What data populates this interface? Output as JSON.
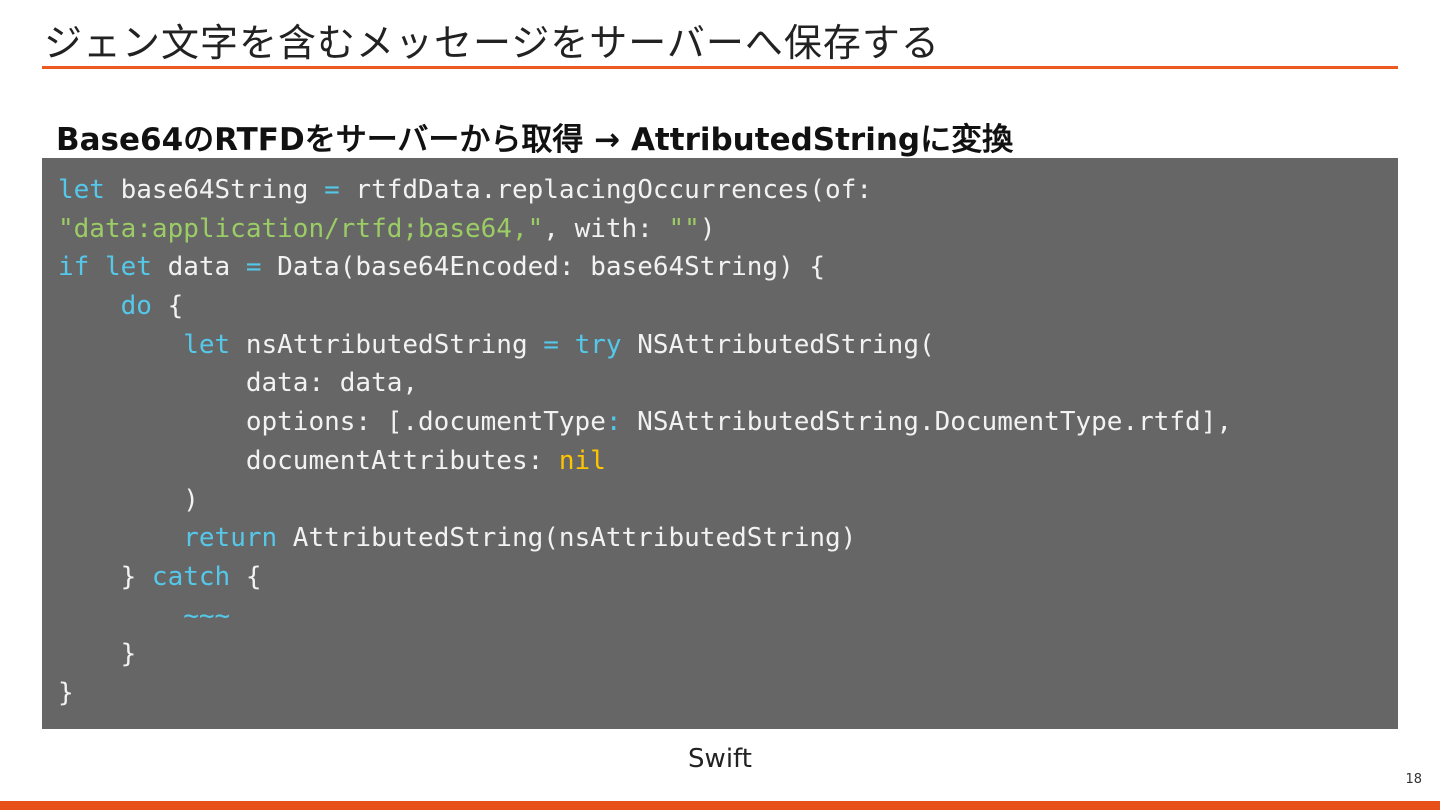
{
  "slide": {
    "title": "ジェン文字を含むメッセージをサーバーへ保存する",
    "subheading": "Base64のRTFDをサーバーから取得 → AttributedStringに変換",
    "code_language": "Swift",
    "page_number": "18"
  },
  "colors": {
    "accent": "#ec5a1f",
    "code_background": "#666666",
    "code_text": "#f2f2f2",
    "keyword": "#55c8ea",
    "string": "#9ccc65",
    "literal": "#ffc400"
  },
  "code_lines": [
    [
      {
        "t": "kw",
        "v": "let"
      },
      {
        "t": "plain",
        "v": " base64String "
      },
      {
        "t": "kw",
        "v": "="
      },
      {
        "t": "plain",
        "v": " rtfdData.replacingOccurrences(of:"
      }
    ],
    [
      {
        "t": "str",
        "v": "\"data:application/rtfd;base64,\""
      },
      {
        "t": "plain",
        "v": ", with: "
      },
      {
        "t": "str",
        "v": "\"\""
      },
      {
        "t": "plain",
        "v": ")"
      }
    ],
    [
      {
        "t": "kw",
        "v": "if"
      },
      {
        "t": "plain",
        "v": " "
      },
      {
        "t": "kw",
        "v": "let"
      },
      {
        "t": "plain",
        "v": " data "
      },
      {
        "t": "kw",
        "v": "="
      },
      {
        "t": "plain",
        "v": " Data(base64Encoded: base64String) {"
      }
    ],
    [
      {
        "t": "plain",
        "v": "    "
      },
      {
        "t": "kw",
        "v": "do"
      },
      {
        "t": "plain",
        "v": " {"
      }
    ],
    [
      {
        "t": "plain",
        "v": "        "
      },
      {
        "t": "kw",
        "v": "let"
      },
      {
        "t": "plain",
        "v": " nsAttributedString "
      },
      {
        "t": "kw",
        "v": "="
      },
      {
        "t": "plain",
        "v": " "
      },
      {
        "t": "kw",
        "v": "try"
      },
      {
        "t": "plain",
        "v": " NSAttributedString("
      }
    ],
    [
      {
        "t": "plain",
        "v": "            data: data,"
      }
    ],
    [
      {
        "t": "plain",
        "v": "            options: [.documentType"
      },
      {
        "t": "kw",
        "v": ":"
      },
      {
        "t": "plain",
        "v": " NSAttributedString.DocumentType.rtfd],"
      }
    ],
    [
      {
        "t": "plain",
        "v": "            documentAttributes: "
      },
      {
        "t": "lit",
        "v": "nil"
      }
    ],
    [
      {
        "t": "plain",
        "v": "        )"
      }
    ],
    [
      {
        "t": "plain",
        "v": "        "
      },
      {
        "t": "kw",
        "v": "return"
      },
      {
        "t": "plain",
        "v": " AttributedString(nsAttributedString)"
      }
    ],
    [
      {
        "t": "plain",
        "v": "    } "
      },
      {
        "t": "kw",
        "v": "catch"
      },
      {
        "t": "plain",
        "v": " {"
      }
    ],
    [
      {
        "t": "plain",
        "v": "        "
      },
      {
        "t": "kw",
        "v": "~~~"
      }
    ],
    [
      {
        "t": "plain",
        "v": "    }"
      }
    ],
    [
      {
        "t": "plain",
        "v": "}"
      }
    ]
  ]
}
